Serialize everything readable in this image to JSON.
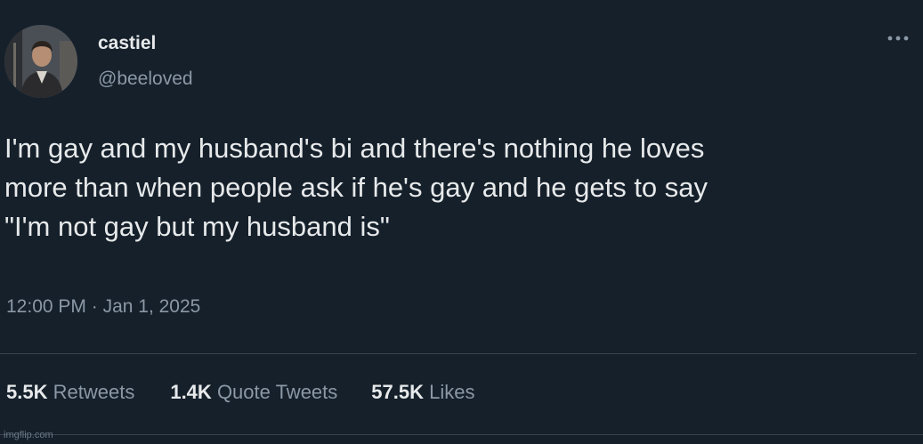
{
  "author": {
    "display_name": "castiel",
    "handle": "@beeloved"
  },
  "tweet": {
    "text": "I'm gay and my husband's bi and there's nothing he loves\nmore than when people ask if he's gay and he gets to say\n\"I'm not gay but my husband is\""
  },
  "meta": {
    "time": "12:00 PM",
    "separator": "·",
    "date": "Jan 1, 2025"
  },
  "stats": {
    "retweets": {
      "count": "5.5K",
      "label": "Retweets"
    },
    "quote_tweets": {
      "count": "1.4K",
      "label": "Quote Tweets"
    },
    "likes": {
      "count": "57.5K",
      "label": "Likes"
    }
  },
  "watermark": "imgflip.com",
  "colors": {
    "background": "#15202b",
    "text_primary": "#e7e9ea",
    "text_secondary": "#8b98a5",
    "divider": "#38444d"
  },
  "icons": {
    "more": "more-horizontal-icon"
  }
}
